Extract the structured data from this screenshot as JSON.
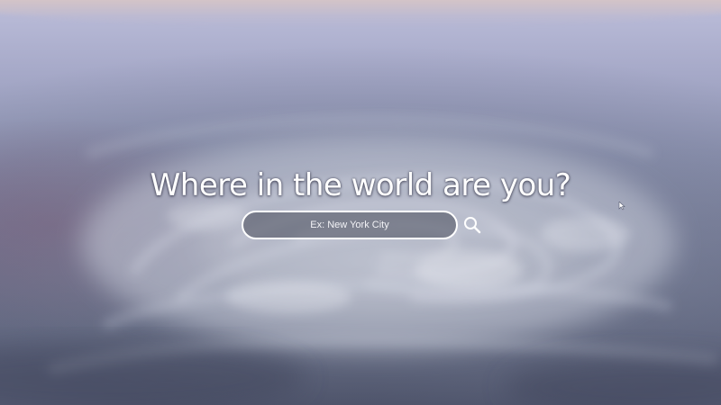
{
  "hero": {
    "headline": "Where in the world are you?"
  },
  "search": {
    "placeholder": "Ex: New York City",
    "value": "",
    "button_icon": "search-icon"
  },
  "background": {
    "description_icon": "earth-hurricane-background"
  },
  "colors": {
    "text": "#ffffff",
    "input_border": "#ffffff",
    "input_fill": "#464858"
  }
}
